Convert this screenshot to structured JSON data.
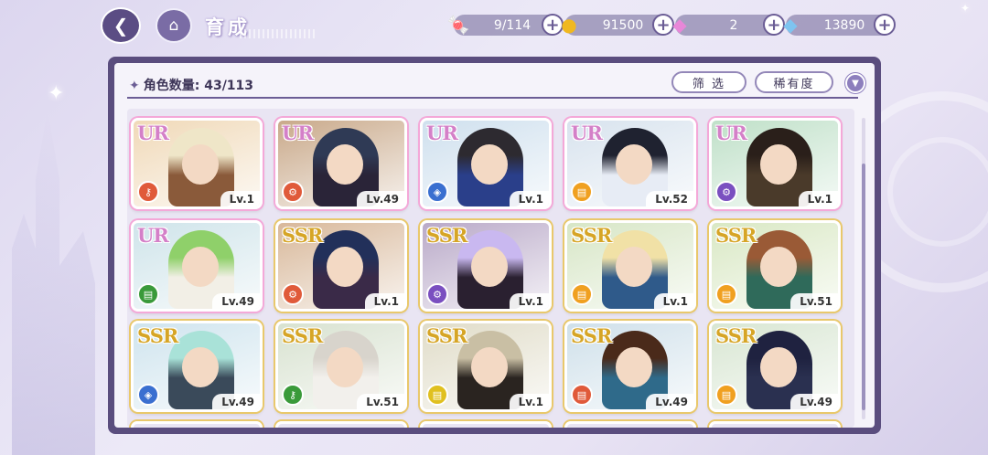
{
  "header": {
    "title": "育成",
    "back_icon": "back-arrow-icon",
    "home_icon": "castle-home-icon"
  },
  "resources": [
    {
      "name": "candy",
      "icon": "candy-icon",
      "glyph": "🍬",
      "value": "9/114"
    },
    {
      "name": "gold",
      "icon": "gold-coin-icon",
      "glyph": "●",
      "value": "91500"
    },
    {
      "name": "pink-gem",
      "icon": "pink-diamond-icon",
      "glyph": "◆",
      "value": "2"
    },
    {
      "name": "blue-gem",
      "icon": "blue-diamond-icon",
      "glyph": "◆",
      "value": "13890"
    }
  ],
  "panel": {
    "count_label": "角色数量: 43/113",
    "filter_label": "筛 选",
    "rarity_label": "稀有度"
  },
  "cards": [
    {
      "rarity": "UR",
      "level": "Lv.1",
      "attr_color": "#e05a3a",
      "attr_icon": "key-icon",
      "attr_glyph": "⚷",
      "bg": "#f0d9b8",
      "hair": "#efe6c8",
      "outfit": "#8a5a3a"
    },
    {
      "rarity": "UR",
      "level": "Lv.49",
      "attr_color": "#e05a3a",
      "attr_icon": "gear-icon",
      "attr_glyph": "⚙",
      "bg": "#c9a98a",
      "hair": "#2f3a55",
      "outfit": "#2a2438"
    },
    {
      "rarity": "UR",
      "level": "Lv.1",
      "attr_color": "#3a6fd0",
      "attr_icon": "shield-icon",
      "attr_glyph": "◈",
      "bg": "#cfe0ee",
      "hair": "#2d2a30",
      "outfit": "#2a3f8a"
    },
    {
      "rarity": "UR",
      "level": "Lv.52",
      "attr_color": "#f0a020",
      "attr_icon": "book-icon",
      "attr_glyph": "▤",
      "bg": "#d8e3ee",
      "hair": "#1f2230",
      "outfit": "#e7ecf5"
    },
    {
      "rarity": "UR",
      "level": "Lv.1",
      "attr_color": "#7a4fc0",
      "attr_icon": "gear-icon",
      "attr_glyph": "⚙",
      "bg": "#bfe0c8",
      "hair": "#2a1f1a",
      "outfit": "#4a3a2a"
    },
    {
      "rarity": "UR",
      "level": "Lv.49",
      "attr_color": "#3a9a3a",
      "attr_icon": "book-icon",
      "attr_glyph": "▤",
      "bg": "#cfe4ea",
      "hair": "#8fd06a",
      "outfit": "#f2efe6"
    },
    {
      "rarity": "SSR",
      "level": "Lv.1",
      "attr_color": "#e05a3a",
      "attr_icon": "gear-icon",
      "attr_glyph": "⚙",
      "bg": "#d8b89a",
      "hair": "#22305a",
      "outfit": "#3a2a48"
    },
    {
      "rarity": "SSR",
      "level": "Lv.1",
      "attr_color": "#7a4fc0",
      "attr_icon": "gear-icon",
      "attr_glyph": "⚙",
      "bg": "#b9a9c8",
      "hair": "#c9b8f0",
      "outfit": "#2a2030"
    },
    {
      "rarity": "SSR",
      "level": "Lv.1",
      "attr_color": "#f0a020",
      "attr_icon": "book-icon",
      "attr_glyph": "▤",
      "bg": "#d7e6c6",
      "hair": "#f1e1a6",
      "outfit": "#2f5a8a"
    },
    {
      "rarity": "SSR",
      "level": "Lv.51",
      "attr_color": "#f0a020",
      "attr_icon": "book-icon",
      "attr_glyph": "▤",
      "bg": "#d9e8c4",
      "hair": "#9a5a36",
      "outfit": "#2f6a5a"
    },
    {
      "rarity": "SSR",
      "level": "Lv.49",
      "attr_color": "#3a6fd0",
      "attr_icon": "shield-icon",
      "attr_glyph": "◈",
      "bg": "#cfe4ee",
      "hair": "#a9e2d8",
      "outfit": "#3a4a5a"
    },
    {
      "rarity": "SSR",
      "level": "Lv.51",
      "attr_color": "#3a9a3a",
      "attr_icon": "key-icon",
      "attr_glyph": "⚷",
      "bg": "#d8e2d0",
      "hair": "#d8d4cc",
      "outfit": "#f2f0ec"
    },
    {
      "rarity": "SSR",
      "level": "Lv.1",
      "attr_color": "#e0c020",
      "attr_icon": "book-icon",
      "attr_glyph": "▤",
      "bg": "#e0dcc8",
      "hair": "#c9bfa4",
      "outfit": "#2a2420"
    },
    {
      "rarity": "SSR",
      "level": "Lv.49",
      "attr_color": "#e05a3a",
      "attr_icon": "book-icon",
      "attr_glyph": "▤",
      "bg": "#cfe0ea",
      "hair": "#4a2a1a",
      "outfit": "#2f6a8a"
    },
    {
      "rarity": "SSR",
      "level": "Lv.49",
      "attr_color": "#f0a020",
      "attr_icon": "book-icon",
      "attr_glyph": "▤",
      "bg": "#d8e6d2",
      "hair": "#1f2240",
      "outfit": "#2a3050"
    }
  ],
  "colors": {
    "accent": "#6b5d95",
    "ur_frame": "#f4a8d8",
    "ssr_frame": "#e9c86b"
  }
}
